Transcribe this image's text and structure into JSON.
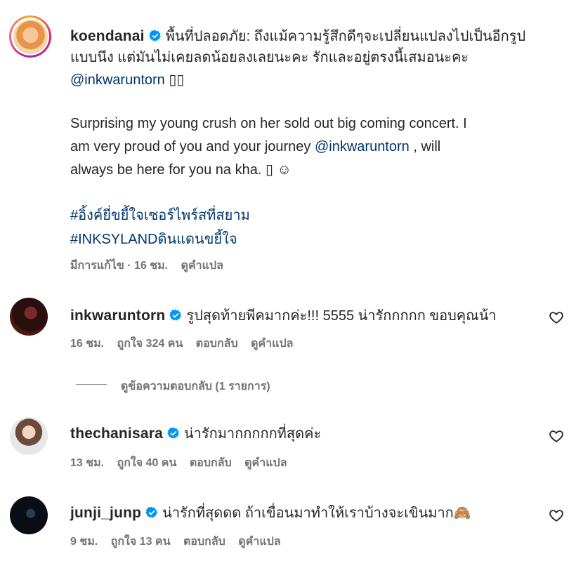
{
  "post_caption": {
    "username": "koendanai",
    "thai_line1": "พื้นที่ปลอดภัย: ถึงแม้ความรู้สึกดีๆจะเปลี่ยนแปลงไปเป็นอีกรูป",
    "thai_line2": "แบบนึง แต่มันไม่เคยลดน้อยลงเลยนะคะ รักและอยู่ตรงนี้เสมอนะคะ",
    "mention": "@inkwaruntorn",
    "mention_suffix": "▯▯",
    "en_line1": "Surprising my young crush on her sold out big coming concert. I",
    "en_line2_pre": "am very proud of you and your journey ",
    "en_line2_mention": "@inkwaruntorn",
    "en_line2_post": " , will",
    "en_line3": "always be here for you na kha. ▯ ☺",
    "hashtag1": "#อิ้งค์ยี่ขยี้ใจเซอร์ไพร์สที่สยาม",
    "hashtag2": "#INKSYLANDดินแดนขยี้ใจ",
    "meta_edited": "มีการแก้ไข · 16 ชม.",
    "meta_translate": "ดูคำแปล"
  },
  "comments": [
    {
      "username": "inkwaruntorn",
      "text": "รูปสุดท้ายพีคมากค่ะ!!! 5555 น่ารักกกกก ขอบคุณน้า",
      "time": "16 ชม.",
      "likes": "ถูกใจ 324 คน",
      "reply": "ตอบกลับ",
      "translate": "ดูคำแปล",
      "view_replies": "ดูข้อความตอบกลับ (1 รายการ)"
    },
    {
      "username": "thechanisara",
      "text": "น่ารักมากกกกกที่สุดค่ะ",
      "time": "13 ชม.",
      "likes": "ถูกใจ 40 คน",
      "reply": "ตอบกลับ",
      "translate": "ดูคำแปล"
    },
    {
      "username": "junji_junp",
      "text": "น่ารักที่สุดดด ถ้าเขื่อนมาทำให้เราบ้างจะเขินมาก🙈",
      "time": "9 ชม.",
      "likes": "ถูกใจ 13 คน",
      "reply": "ตอบกลับ",
      "translate": "ดูคำแปล"
    }
  ],
  "colors": {
    "link": "#00376b",
    "verified": "#0095f6",
    "meta": "#737373",
    "text": "#262626"
  }
}
